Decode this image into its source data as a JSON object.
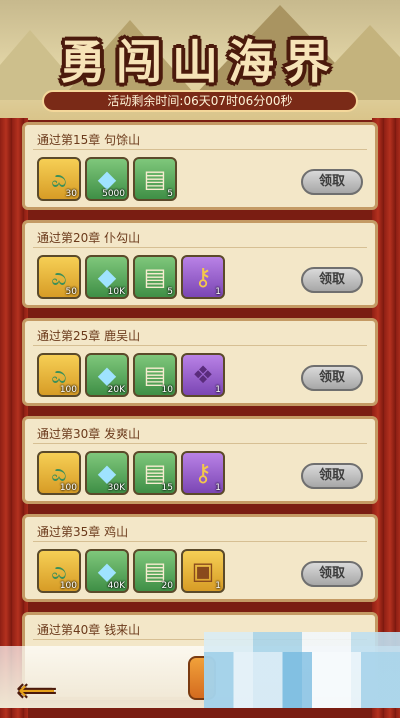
{
  "header": {
    "title": "勇闯山海界",
    "timer_label": "活动剩余时间:",
    "timer_value": "06天07时06分00秒"
  },
  "claim_label": "领取",
  "icons": {
    "jade": "jade-dragon-icon",
    "crystal": "blue-crystal-icon",
    "scroll": "scroll-icon",
    "key": "gold-key-icon",
    "bag": "purple-bag-icon",
    "chest": "treasure-chest-icon"
  },
  "cards": [
    {
      "name": "通过第15章 句馀山",
      "items": [
        {
          "qty": "30"
        },
        {
          "qty": "5000"
        },
        {
          "qty": "5"
        }
      ]
    },
    {
      "name": "通过第20章 仆勾山",
      "items": [
        {
          "qty": "50"
        },
        {
          "qty": "10K"
        },
        {
          "qty": "5"
        },
        {
          "qty": "1"
        }
      ]
    },
    {
      "name": "通过第25章 鹿吴山",
      "items": [
        {
          "qty": "100"
        },
        {
          "qty": "20K"
        },
        {
          "qty": "10"
        },
        {
          "qty": "1"
        }
      ]
    },
    {
      "name": "通过第30章 发爽山",
      "items": [
        {
          "qty": "100"
        },
        {
          "qty": "30K"
        },
        {
          "qty": "15"
        },
        {
          "qty": "1"
        }
      ]
    },
    {
      "name": "通过第35章 鸡山",
      "items": [
        {
          "qty": "100"
        },
        {
          "qty": "40K"
        },
        {
          "qty": "20"
        },
        {
          "qty": "1"
        }
      ]
    },
    {
      "name": "通过第40章 钱来山"
    }
  ],
  "colors": {
    "accent": "#e6a21a",
    "frame": "#7a1d12",
    "card": "#f3e7c8"
  }
}
